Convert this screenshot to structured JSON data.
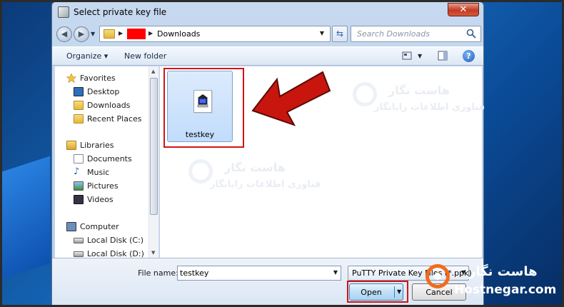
{
  "window": {
    "title": "Select private key file",
    "close_glyph": "✕"
  },
  "address_bar": {
    "path_segments": [
      "",
      "Downloads"
    ],
    "redacted_segment_color": "#ff0000"
  },
  "search": {
    "placeholder": "Search Downloads",
    "icon": "search-icon"
  },
  "toolbar": {
    "organize_label": "Organize",
    "new_folder_label": "New folder",
    "help_glyph": "?"
  },
  "nav_pane": {
    "favorites": {
      "label": "Favorites",
      "items": [
        {
          "label": "Desktop",
          "icon": "desktop-icon"
        },
        {
          "label": "Downloads",
          "icon": "downloads-icon"
        },
        {
          "label": "Recent Places",
          "icon": "recent-places-icon"
        }
      ]
    },
    "libraries": {
      "label": "Libraries",
      "items": [
        {
          "label": "Documents",
          "icon": "documents-icon"
        },
        {
          "label": "Music",
          "icon": "music-icon"
        },
        {
          "label": "Pictures",
          "icon": "pictures-icon"
        },
        {
          "label": "Videos",
          "icon": "videos-icon"
        }
      ]
    },
    "computer": {
      "label": "Computer",
      "items": [
        {
          "label": "Local Disk (C:)",
          "icon": "disk-icon"
        },
        {
          "label": "Local Disk (D:)",
          "icon": "disk-icon"
        }
      ]
    }
  },
  "files": [
    {
      "name": "testkey",
      "selected": true,
      "icon": "putty-key-file-icon"
    }
  ],
  "watermark": {
    "fa_title": "هاست نگار",
    "fa_subtitle": "فناوری اطلاعات رایانگار"
  },
  "footer": {
    "file_name_label": "File name:",
    "file_name_value": "testkey",
    "filter_value": "PuTTY Private Key Files (*.ppk)",
    "open_label": "Open",
    "cancel_label": "Cancel"
  },
  "brand": {
    "fa_name": "هاست نگار",
    "domain": "Hostnegar.com",
    "accent": "#f26b1d"
  },
  "annotation_color": "#d21414"
}
